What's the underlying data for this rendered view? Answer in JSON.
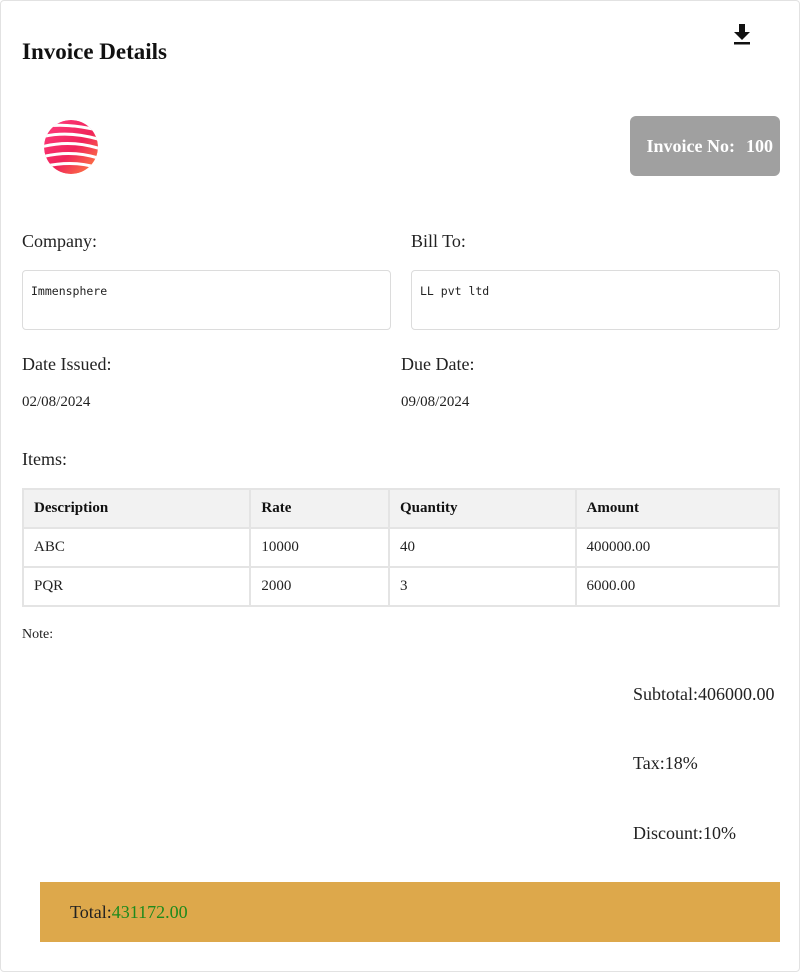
{
  "header": {
    "title": "Invoice Details",
    "download_icon": "download-icon"
  },
  "logo": {
    "icon": "striped-sphere-logo"
  },
  "invoice": {
    "label": "Invoice No:",
    "number": "100"
  },
  "company": {
    "label": "Company:",
    "value": "Immensphere"
  },
  "bill_to": {
    "label": "Bill To:",
    "value": "LL pvt ltd"
  },
  "dates": {
    "issued_label": "Date Issued:",
    "issued_value": "02/08/2024",
    "due_label": "Due Date:",
    "due_value": "09/08/2024"
  },
  "items": {
    "label": "Items:",
    "columns": [
      "Description",
      "Rate",
      "Quantity",
      "Amount"
    ],
    "rows": [
      [
        "ABC",
        "10000",
        "40",
        "400000.00"
      ],
      [
        "PQR",
        "2000",
        "3",
        "6000.00"
      ]
    ]
  },
  "note": {
    "label": "Note:"
  },
  "summary": {
    "subtotal_label": "Subtotal:",
    "subtotal_value": "406000.00",
    "tax_label": "Tax:",
    "tax_value": "18%",
    "discount_label": "Discount:",
    "discount_value": "10%"
  },
  "total": {
    "label": "Total:",
    "value": "431172.00"
  },
  "colors": {
    "badge_bg": "#a0a0a0",
    "total_bar_bg": "#dda84b",
    "total_value": "#1d8a1d"
  }
}
